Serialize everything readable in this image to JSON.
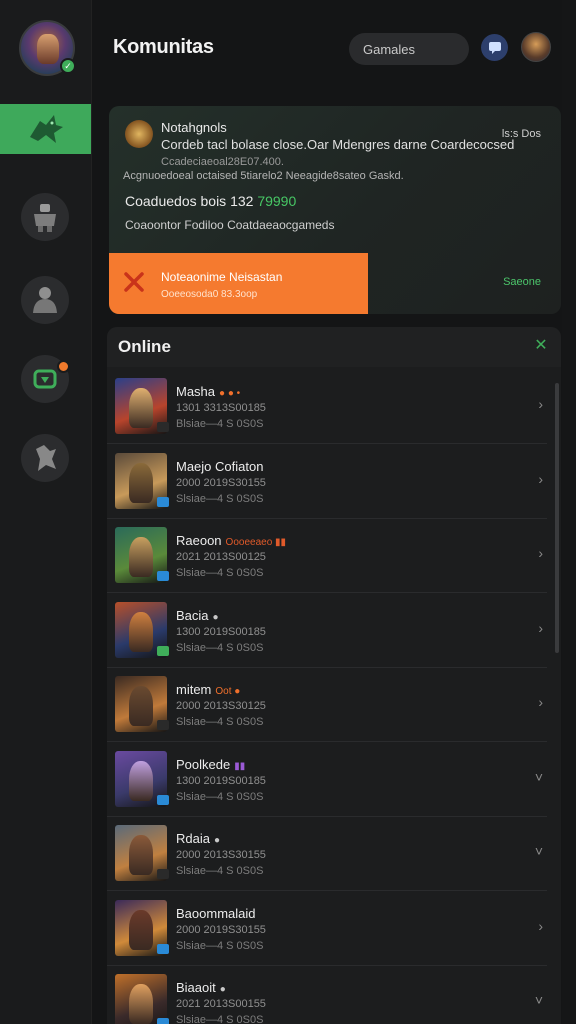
{
  "header": {
    "title": "Komunitas",
    "search_value": "Gamales"
  },
  "notification": {
    "title": "Notahgnols",
    "line1": "Cordeb tacl bolase close.Oar Mdengres darne Coardecocsed",
    "time": "ls:s Dos",
    "subline": "Ccadeciaeoal28E07.400.",
    "description": "Acgnuoedoeal octaised 5tiarelo2 Neeagide8sateo Gaskd.",
    "stats_label": "Coaduedos bois 132",
    "stats_value": "79990",
    "tags": "Coaoontor Fodiloo Coatdaeaocgameds",
    "alert": {
      "title": "Noteaonime Neisastan",
      "subtitle": "Ooeeosoda0 83.3oop"
    },
    "action": "Saeone"
  },
  "online": {
    "title": "Online",
    "rows": [
      {
        "name": "Masha",
        "tag": "● ● •",
        "tag_color": "#f0702c",
        "meta1": "1301 3313S00185",
        "meta2": "Blsiae—4 S 0S0S"
      },
      {
        "name": "Maejo Cofiaton",
        "tag": "",
        "tag_color": "#f0702c",
        "meta1": "2000 2019S30155",
        "meta2": "Slsiae—4 S 0S0S"
      },
      {
        "name": "Raeoon",
        "tag": "Oooeeaeo ▮▮",
        "tag_color": "#e05a2a",
        "meta1": "2021 2013S00125",
        "meta2": "Slsiae—4 S 0S0S"
      },
      {
        "name": "Bacia",
        "tag": "●",
        "tag_color": "#c8c8c8",
        "meta1": "1300 2019S00185",
        "meta2": "Slsiae—4 S 0S0S"
      },
      {
        "name": "mitem",
        "tag": "Oot ●",
        "tag_color": "#f0702c",
        "meta1": "2000 2013S30125",
        "meta2": "Slsiae—4 S 0S0S"
      },
      {
        "name": "Poolkede",
        "tag": "▮▮",
        "tag_color": "#9b5ad6",
        "meta1": "1300 2019S00185",
        "meta2": "Slsiae—4 S 0S0S"
      },
      {
        "name": "Rdaia",
        "tag": "●",
        "tag_color": "#c8c8c8",
        "meta1": "2000 2013S30155",
        "meta2": "Slsiae—4 S 0S0S"
      },
      {
        "name": "Baoommalaid",
        "tag": "",
        "tag_color": "#c8c8c8",
        "meta1": "2000 2019S30155",
        "meta2": "Slsiae—4 S 0S0S"
      },
      {
        "name": "Biaaoit",
        "tag": "●",
        "tag_color": "#c8c8c8",
        "meta1": "2021 2013S00155",
        "meta2": "Slsiae—4 S 0S0S"
      }
    ]
  },
  "colors": {
    "accent_green": "#3ea95b",
    "accent_orange": "#f57a2f",
    "background": "#141516"
  },
  "icons": {
    "rail": [
      "dragon-icon",
      "robot-warrior-icon",
      "brute-icon",
      "game-controller-icon",
      "mech-icon"
    ],
    "header": [
      "chat-icon",
      "profile-avatar"
    ]
  }
}
